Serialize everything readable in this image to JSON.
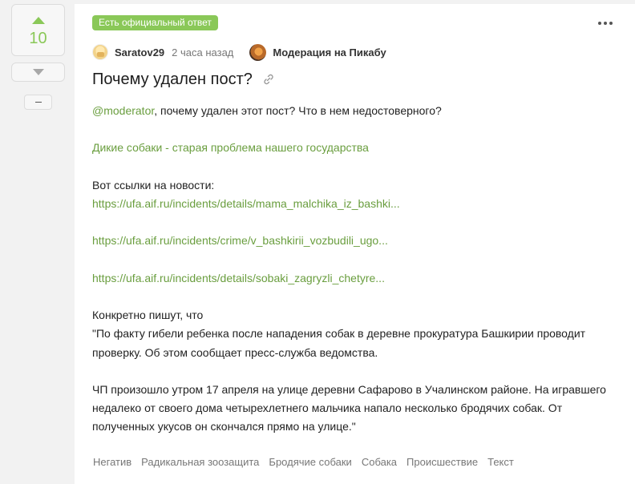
{
  "rating": {
    "score": "10"
  },
  "post": {
    "badge": "Есть официальный ответ",
    "author": "Saratov29",
    "time": "2 часа назад",
    "community": "Модерация на Пикабу",
    "title": "Почему удален пост?",
    "mention": "@moderator",
    "intro_rest": ", почему удален этот пост? Что в нем недостоверного?",
    "linked_post": "Дикие собаки - старая проблема нашего государства",
    "links_header": "Вот ссылки на новости:",
    "links": [
      "https://ufa.aif.ru/incidents/details/mama_malchika_iz_bashki...",
      "https://ufa.aif.ru/incidents/crime/v_bashkirii_vozbudili_ugo...",
      "https://ufa.aif.ru/incidents/details/sobaki_zagryzli_chetyre..."
    ],
    "quote_intro": "Конкретно пишут, что",
    "quote_1a": "\"По факту гибели ребенка после нападения собак в деревне прокуратура Башкирии проводит",
    "quote_1b": "проверку. Об этом сообщает пресс-служба ведомства.",
    "quote_2a": "ЧП произошло утром 17 апреля на улице деревни Сафарово в Учалинском районе. На игравшего",
    "quote_2b": "недалеко от своего дома четырехлетнего мальчика напало несколько бродячих собак. От",
    "quote_2c": "полученных укусов он скончался прямо на улице.\""
  },
  "tags": [
    "Негатив",
    "Радикальная зоозащита",
    "Бродячие собаки",
    "Собака",
    "Происшествие",
    "Текст"
  ],
  "colors": {
    "accent": "#8ac858",
    "link": "#6a9e3f",
    "background": "#f2f2f2"
  }
}
